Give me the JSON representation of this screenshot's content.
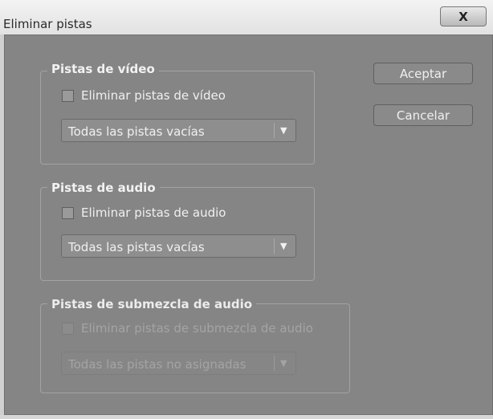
{
  "window": {
    "title": "Eliminar pistas",
    "close_glyph": "X"
  },
  "video": {
    "title": "Pistas de vídeo",
    "checkbox_label": "Eliminar pistas de vídeo",
    "checked": false,
    "select_value": "Todas las pistas vacías",
    "arrow": "▼"
  },
  "audio": {
    "title": "Pistas de audio",
    "checkbox_label": "Eliminar pistas de audio",
    "checked": false,
    "select_value": "Todas las pistas vacías",
    "arrow": "▼"
  },
  "submix": {
    "title": "Pistas de submezcla de audio",
    "checkbox_label": "Eliminar pistas de submezcla de audio",
    "checked": false,
    "enabled": false,
    "select_value": "Todas las pistas no asignadas",
    "arrow": "▼"
  },
  "buttons": {
    "ok": "Aceptar",
    "cancel": "Cancelar"
  }
}
